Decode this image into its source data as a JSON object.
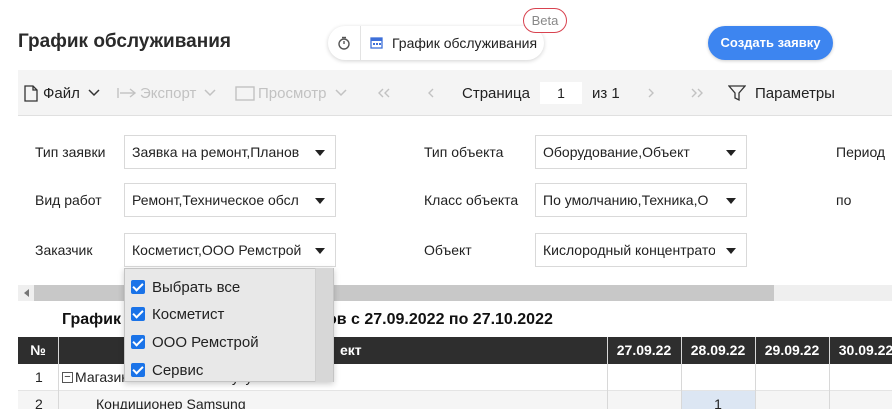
{
  "header": {
    "title": "График обслуживания",
    "tab_label": "График обслуживания",
    "beta": "Beta",
    "create_button": "Создать заявку"
  },
  "toolbar": {
    "file": "Файл",
    "export": "Экспорт",
    "preview": "Просмотр",
    "page_label": "Страница",
    "page_value": "1",
    "of_label": "из 1",
    "params": "Параметры"
  },
  "filters": {
    "type_label": "Тип заявки",
    "type_value": "Заявка на ремонт,Планов",
    "work_label": "Вид работ",
    "work_value": "Ремонт,Техническое обсл",
    "customer_label": "Заказчик",
    "customer_value": "Косметист,ООО Ремстрой",
    "obj_type_label": "Тип объекта",
    "obj_type_value": "Оборудование,Объект",
    "obj_class_label": "Класс объекта",
    "obj_class_value": "По умолчанию,Техника,О",
    "object_label": "Объект",
    "object_value": "Кислородный концентрато",
    "period_label": "Период",
    "to_label": "по"
  },
  "customer_dropdown": {
    "options": [
      "Выбрать все",
      "Косметист",
      "ООО Ремстрой",
      "Сервис"
    ]
  },
  "schedule": {
    "title": "График",
    "title_tail": "ов с 27.09.2022 по 27.10.2022",
    "col_num": "№",
    "col_object": "ект",
    "dates": [
      "27.09.22",
      "28.09.22",
      "29.09.22",
      "30.09.22"
    ],
    "rows": [
      {
        "num": "1",
        "name": "Магазин Косметист на Кутузов",
        "toggle": "−"
      },
      {
        "num": "2",
        "name": "Кондиционер Samsung",
        "value_28": "1"
      }
    ]
  },
  "colors": {
    "accent": "#3d85f0",
    "beta_border": "#d8424f",
    "table_header": "#2e2e2e",
    "checkbox": "#1a73e8"
  }
}
